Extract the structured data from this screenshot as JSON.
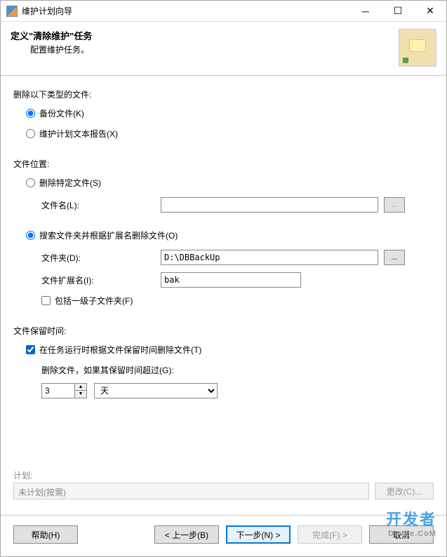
{
  "title": "维护计划向导",
  "header": {
    "h1": "定义\"清除维护\"任务",
    "h2": "配置维护任务。"
  },
  "section1": {
    "label": "删除以下类型的文件:",
    "opt_backup": "备份文件(K)",
    "opt_report": "维护计划文本报告(X)"
  },
  "section2": {
    "label": "文件位置:",
    "opt_specific": "删除特定文件(S)",
    "filename_label": "文件名(L):",
    "filename_value": "",
    "opt_search": "搜索文件夹并根据扩展名删除文件(O)",
    "folder_label": "文件夹(D):",
    "folder_value": "D:\\DBBackUp",
    "ext_label": "文件扩展名(I):",
    "ext_value": "bak",
    "chk_subfolder": "包括一级子文件夹(F)"
  },
  "section3": {
    "label": "文件保留时间:",
    "chk_age": "在任务运行时根据文件保留时间删除文件(T)",
    "age_label": "删除文件，如果其保留时间超过(G):",
    "age_value": "3",
    "age_unit": "天"
  },
  "plan": {
    "label": "计划:",
    "value": "未计划(按需)",
    "change": "更改(C)..."
  },
  "footer": {
    "help": "帮助(H)",
    "back": "< 上一步(B)",
    "next": "下一步(N) >",
    "finish": "完成(F) >",
    "cancel": "取消"
  },
  "watermark": {
    "main": "开发者",
    "sub": "DevZe.CoM"
  }
}
